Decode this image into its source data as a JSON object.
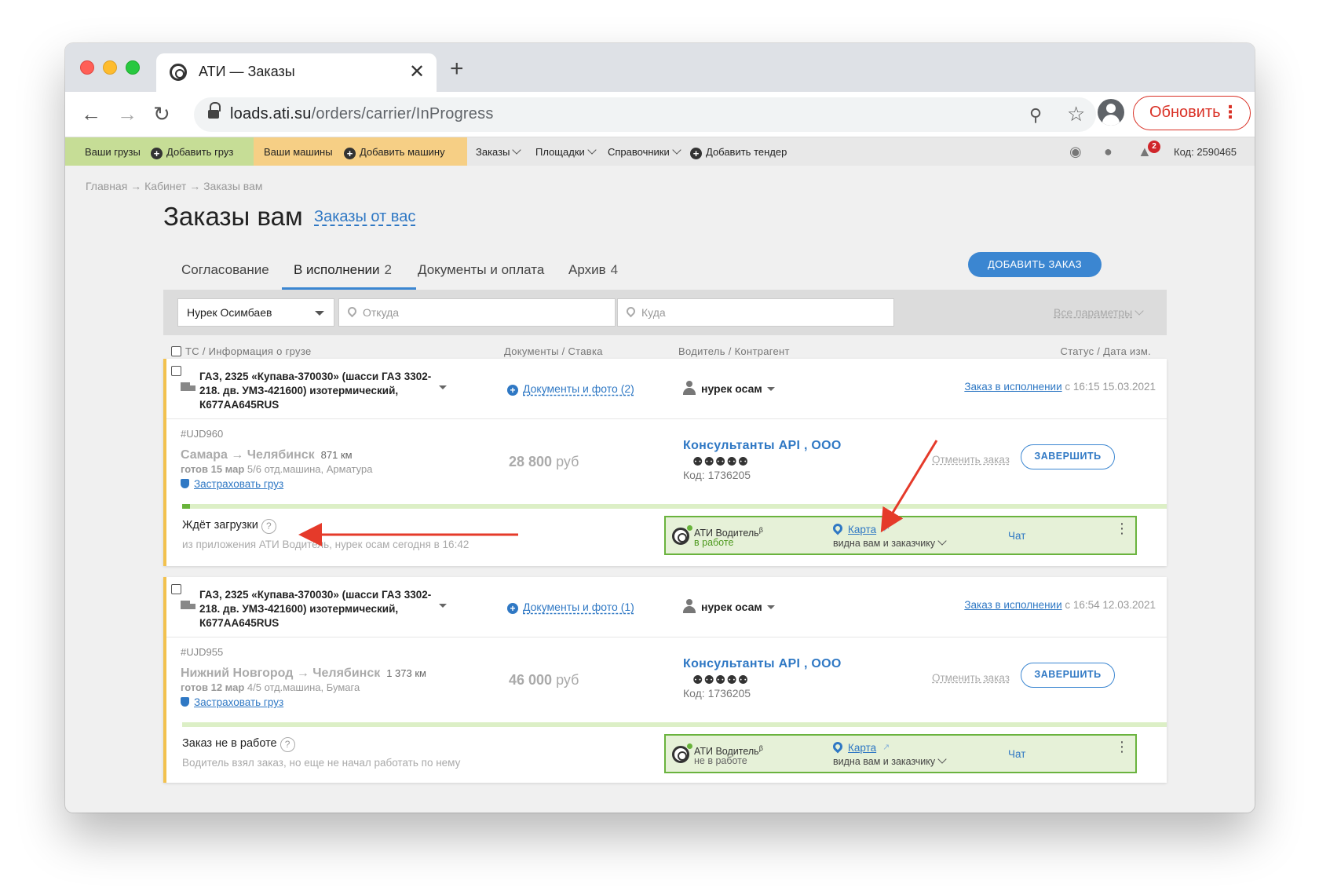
{
  "browser": {
    "tab_title": "АТИ — Заказы",
    "tab_close": "✕",
    "new_tab": "+",
    "url_host": "loads.ati.su",
    "url_path": "/orders/carrier/InProgress",
    "update_label": "Обновить",
    "back": "←",
    "forward": "→",
    "reload": "↻"
  },
  "sitenav": {
    "your_loads": "Ваши грузы",
    "add_load": "Добавить груз",
    "your_trucks": "Ваши машины",
    "add_truck": "Добавить машину",
    "orders": "Заказы",
    "platforms": "Площадки",
    "directories": "Справочники",
    "add_tender": "Добавить тендер",
    "notifications_count": "2",
    "code": "Код: 2590465"
  },
  "page": {
    "breadcrumb": "Главная → Кабинет → Заказы вам",
    "title": "Заказы вам",
    "title_link": "Заказы от вас",
    "tabs": [
      {
        "label": "Согласование",
        "count": ""
      },
      {
        "label": "В исполнении",
        "count": "2"
      },
      {
        "label": "Документы и оплата",
        "count": ""
      },
      {
        "label": "Архив",
        "count": "4"
      }
    ],
    "add_order": "ДОБАВИТЬ ЗАКАЗ"
  },
  "filters": {
    "contractor": "Нурек Осимбаев",
    "from_placeholder": "Откуда",
    "to_placeholder": "Куда",
    "all_params": "Все параметры"
  },
  "columns": {
    "ts": "ТС / Информация о грузе",
    "docs": "Документы / Ставка",
    "driver": "Водитель / Контрагент",
    "status": "Статус / Дата изм."
  },
  "orders": [
    {
      "truck": "ГАЗ, 2325 «Купава-370030» (шасси ГАЗ 3302-218. дв. УМЗ-421600) изотермический, К677АА645RUS",
      "docs": "Документы и фото (2)",
      "driver": "нурек осам",
      "status_link": "Заказ в исполнении",
      "status_date": "с 16:15 15.03.2021",
      "id": "#UJD960",
      "route": "Самара → Челябинск",
      "distance": "871 км",
      "ready_date": "готов 15 мар",
      "cargo": "5/6 отд.машина, Арматура",
      "insure": "Застраховать груз",
      "price_value": "28 800",
      "price_currency": "руб",
      "company": "Консультанты API , ООО",
      "rating": "⚉⚉⚉⚉⚉",
      "company_code": "Код: 1736205",
      "cancel": "Отменить заказ",
      "finish": "ЗАВЕРШИТЬ",
      "progress": 0.008,
      "state_label": "Ждёт загрузки",
      "state_sub": "из приложения АТИ Водитель, нурек осам сегодня в 16:42",
      "app_name": "АТИ Водитель",
      "app_beta": "β",
      "app_state": "в работе",
      "app_state_color": "#4e9a1f",
      "map": "Карта",
      "map_visibility": "видна вам и заказчику",
      "chat": "Чат"
    },
    {
      "truck": "ГАЗ, 2325 «Купава-370030» (шасси ГАЗ 3302-218. дв. УМЗ-421600) изотермический, К677АА645RUS",
      "docs": "Документы и фото (1)",
      "driver": "нурек осам",
      "status_link": "Заказ в исполнении",
      "status_date": "с 16:54 12.03.2021",
      "id": "#UJD955",
      "route": "Нижний Новгород → Челябинск",
      "distance": "1 373 км",
      "ready_date": "готов 12 мар",
      "cargo": "4/5 отд.машина, Бумага",
      "insure": "Застраховать груз",
      "price_value": "46 000",
      "price_currency": "руб",
      "company": "Консультанты API , ООО",
      "rating": "⚉⚉⚉⚉⚉",
      "company_code": "Код: 1736205",
      "cancel": "Отменить заказ",
      "finish": "ЗАВЕРШИТЬ",
      "progress": 0,
      "state_label": "Заказ не в работе",
      "state_sub": "Водитель взял заказ, но еще не начал работать по нему",
      "app_name": "АТИ Водитель",
      "app_beta": "β",
      "app_state": "не в работе",
      "app_state_color": "#666666",
      "map": "Карта",
      "map_visibility": "видна вам и заказчику",
      "chat": "Чат"
    }
  ],
  "colors": {
    "accent": "#3b86d1",
    "link": "#2f78c4",
    "annotation_arrow": "#e53a2a",
    "card_stripe": "#f2c14e",
    "app_box_border": "#6ab33e"
  }
}
